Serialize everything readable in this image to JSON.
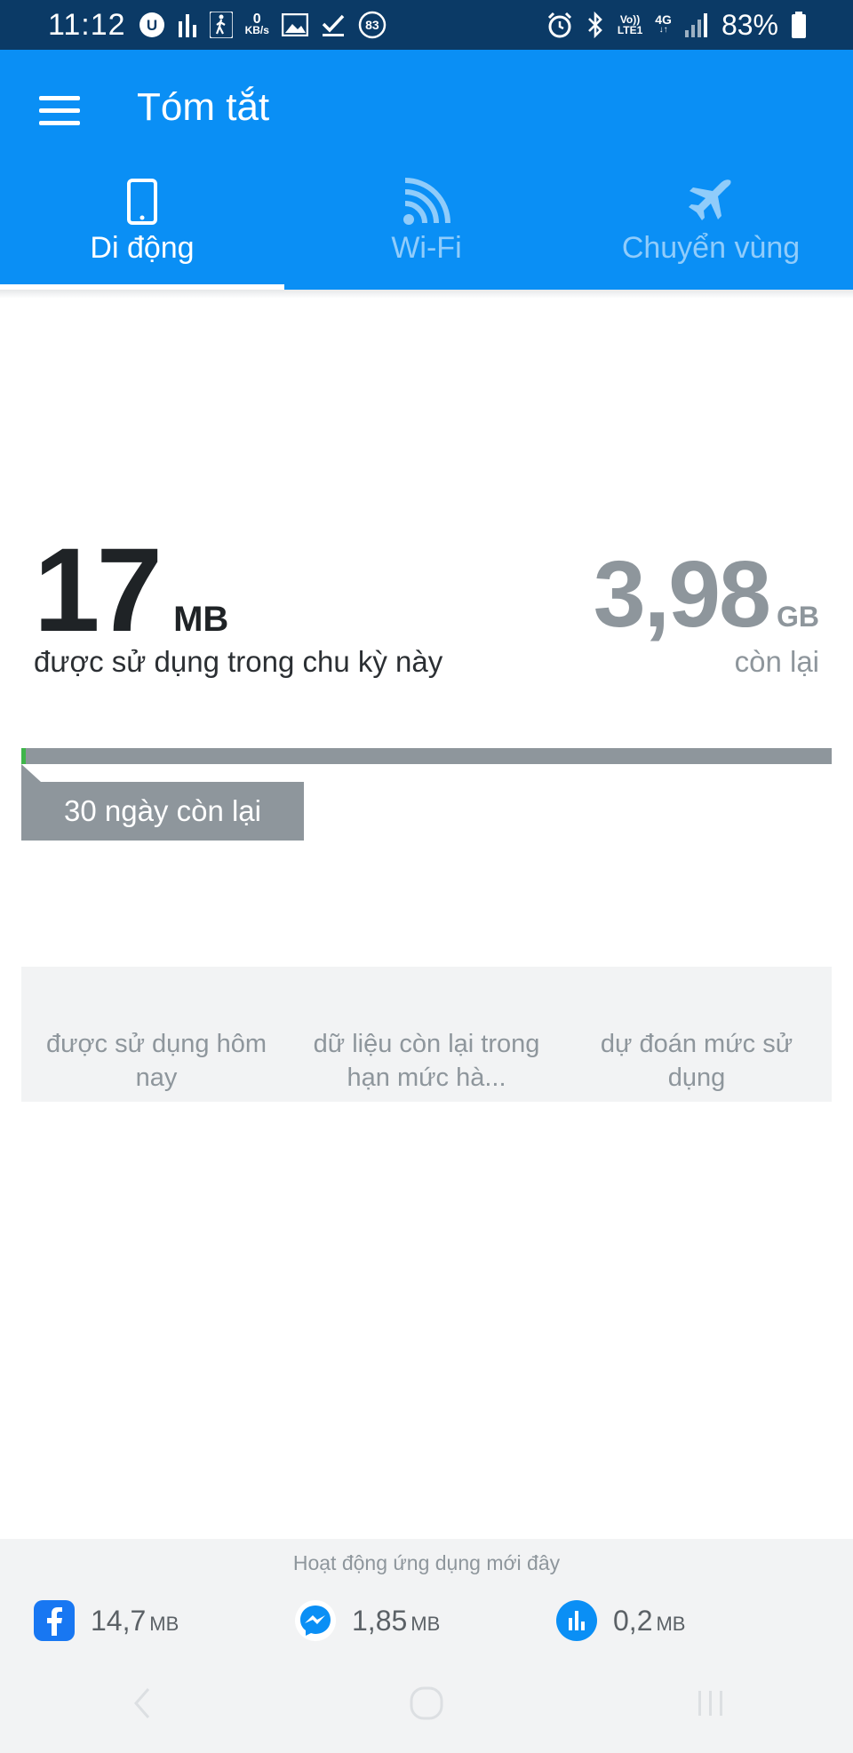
{
  "status_bar": {
    "time": "11:12",
    "net_speed_value": "0",
    "net_speed_unit": "KB/s",
    "notification_count": "83",
    "volte_label": "Vo))",
    "lte_label": "LTE1",
    "network_type": "4G",
    "battery": "83%"
  },
  "app_bar": {
    "title": "Tóm tắt"
  },
  "tabs": [
    {
      "label": "Di động",
      "icon": "phone-icon",
      "selected": true
    },
    {
      "label": "Wi-Fi",
      "icon": "wifi-icon",
      "selected": false
    },
    {
      "label": "Chuyển vùng",
      "icon": "airplane-icon",
      "selected": false
    }
  ],
  "usage": {
    "used_value": "17",
    "used_unit": "MB",
    "used_caption": "được sử dụng trong chu kỳ này",
    "remaining_value": "3,98",
    "remaining_unit": "GB",
    "remaining_caption": "còn lại",
    "progress_fraction": 0.004,
    "days_left_label": "30 ngày còn lại"
  },
  "stats": [
    {
      "label": "được sử dụng hôm nay"
    },
    {
      "label": "dữ liệu còn lại trong hạn mức hà..."
    },
    {
      "label": "dự đoán mức sử dụng"
    }
  ],
  "recent_activity": {
    "title": "Hoạt động ứng dụng mới đây",
    "apps": [
      {
        "icon": "facebook-icon",
        "value": "14,7",
        "unit": "MB"
      },
      {
        "icon": "messenger-icon",
        "value": "1,85",
        "unit": "MB"
      },
      {
        "icon": "data-meter-icon",
        "value": "0,2",
        "unit": "MB"
      }
    ]
  },
  "colors": {
    "status_bar": "#0b3a66",
    "app_bar": "#0a8ff5",
    "progress_track": "#8e969c",
    "progress_fill": "#3fb54a",
    "muted_text": "#8e969c"
  }
}
